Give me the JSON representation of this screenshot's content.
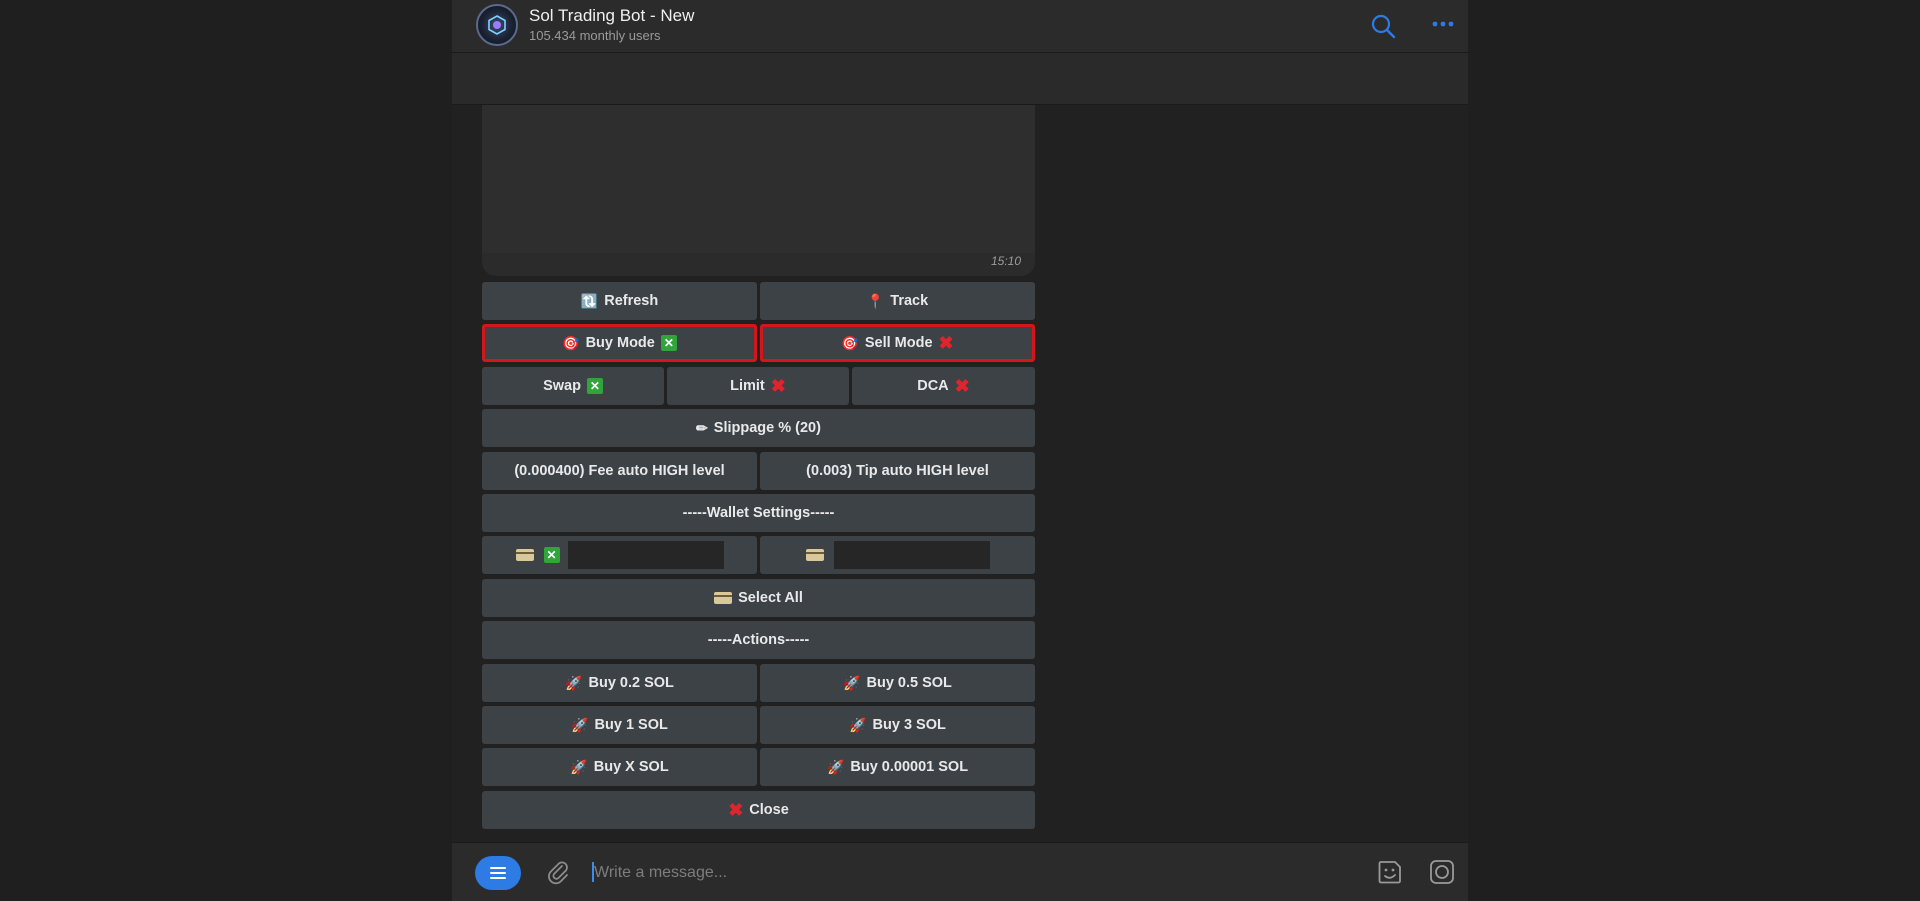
{
  "header": {
    "title": "Sol Trading Bot - New",
    "subtitle": "105.434 monthly users",
    "icons": [
      "search-icon",
      "more-icon"
    ],
    "accent_color": "#2d7be5"
  },
  "message": {
    "time": "15:10"
  },
  "buttons": {
    "refresh": "Refresh",
    "track": "Track",
    "buy_mode": "Buy Mode",
    "sell_mode": "Sell Mode",
    "swap": "Swap",
    "limit": "Limit",
    "dca": "DCA",
    "slippage": "Slippage % (20)",
    "fee": "(0.000400) Fee auto HIGH level",
    "tip": "(0.003) Tip auto HIGH level",
    "wallet_settings": "-----Wallet Settings-----",
    "select_all": "Select All",
    "actions": "-----Actions-----",
    "buy_02": "Buy 0.2 SOL",
    "buy_05": "Buy 0.5 SOL",
    "buy_1": "Buy 1 SOL",
    "buy_3": "Buy 3 SOL",
    "buy_x": "Buy X SOL",
    "buy_000001": "Buy 0.00001 SOL",
    "close": "Close"
  },
  "status": {
    "enabled_mark": "✕",
    "disabled_mark": "✖",
    "enabled_color": "#2fa53a",
    "disabled_color": "#e0242b",
    "highlight_color": "#d3161b"
  },
  "composer": {
    "placeholder": "Write a message..."
  }
}
